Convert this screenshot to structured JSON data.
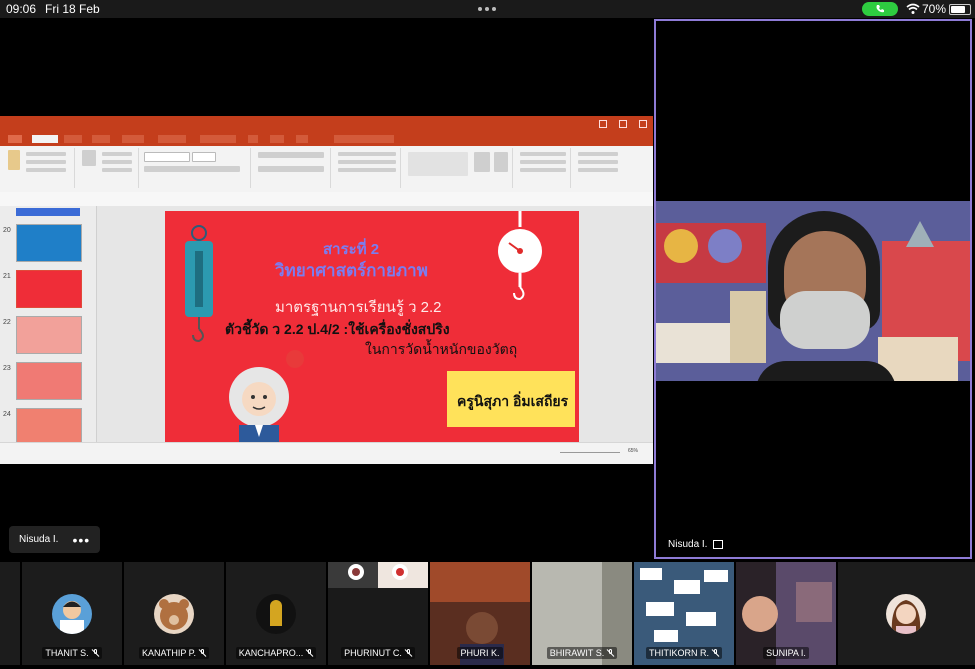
{
  "status": {
    "time": "09:06",
    "date": "Fri 18 Feb",
    "battery": "70%",
    "battery_level": 0.7
  },
  "slide": {
    "line1": "สาระที่ 2",
    "line2": "วิทยาศาสตร์กายภาพ",
    "line3": "มาตรฐานการเรียนรู้ ว 2.2",
    "line4": "ตัวชี้วัด ว 2.2  ป.4/2 :ใช้เครื่องชั่งสปริง",
    "line5": "ในการวัดน้ำหนักของวัตถุ",
    "teacher": "ครูนิสุภา อิ่มเสถียร"
  },
  "ppt": {
    "thumb_numbers": [
      "20",
      "21",
      "22",
      "23",
      "24"
    ],
    "zoom": "65%"
  },
  "speaker": {
    "name": "Nisuda I."
  },
  "main_label": {
    "name": "Nisuda I.",
    "more": "•••"
  },
  "participants": [
    {
      "name": "THANIT S."
    },
    {
      "name": "KANATHIP P."
    },
    {
      "name": "KANCHAPRO..."
    },
    {
      "name": "PHURINUT C."
    },
    {
      "name": "PHURI K."
    },
    {
      "name": "BHIRAWIT S."
    },
    {
      "name": "THITIKORN R."
    },
    {
      "name": "SUNIPA I."
    }
  ]
}
